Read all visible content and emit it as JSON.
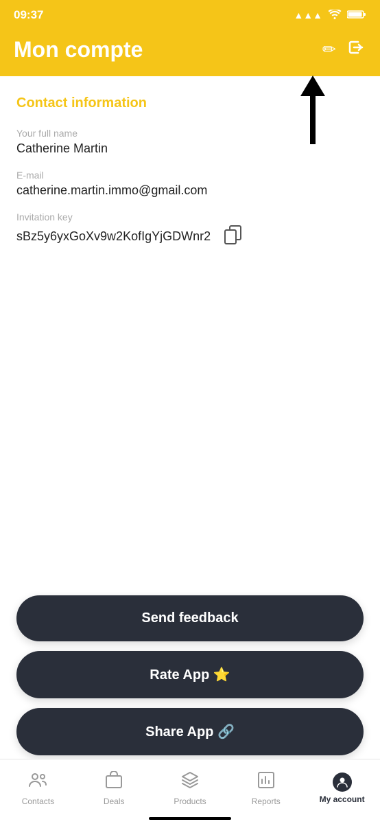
{
  "statusBar": {
    "time": "09:37"
  },
  "header": {
    "title": "Mon compte",
    "editIcon": "✏",
    "logoutIcon": "⇥"
  },
  "contactSection": {
    "sectionTitle": "Contact information",
    "fields": [
      {
        "label": "Your full name",
        "value": "Catherine Martin"
      },
      {
        "label": "E-mail",
        "value": "catherine.martin.immo@gmail.com"
      },
      {
        "label": "Invitation key",
        "value": "sBz5y6yxGoXv9w2KofIgYjGDWnr2"
      }
    ]
  },
  "buttons": [
    {
      "id": "send-feedback",
      "label": "Send feedback"
    },
    {
      "id": "rate-app",
      "label": "Rate App ⭐"
    },
    {
      "id": "share-app",
      "label": "Share App 🔗"
    }
  ],
  "bottomNav": [
    {
      "id": "contacts",
      "label": "Contacts",
      "icon": "👥",
      "active": false
    },
    {
      "id": "deals",
      "label": "Deals",
      "icon": "💼",
      "active": false
    },
    {
      "id": "products",
      "label": "Products",
      "icon": "📦",
      "active": false
    },
    {
      "id": "reports",
      "label": "Reports",
      "icon": "📊",
      "active": false
    },
    {
      "id": "my-account",
      "label": "My account",
      "icon": "👤",
      "active": true
    }
  ]
}
